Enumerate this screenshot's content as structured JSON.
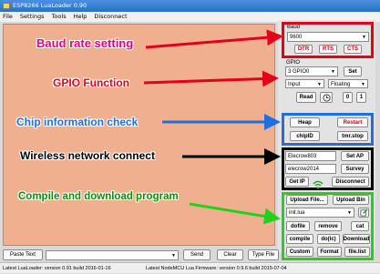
{
  "window": {
    "title": "ESP8266 LuaLoader 0.90"
  },
  "menu": {
    "items": [
      "File",
      "Settings",
      "Tools",
      "Help",
      "Disconnect"
    ]
  },
  "annotations": {
    "baud": "Baud rate setting",
    "gpio": "GPIO Function",
    "chip": "Chip information check",
    "wireless": "Wireless network connect",
    "compile": "Compile and download program"
  },
  "colors": {
    "red": "#e3001b",
    "blue": "#1f6fe0",
    "black": "#000000",
    "green": "#21d11b",
    "magenta": "#e4007f",
    "editor_bg": "#f0b08f"
  },
  "baud": {
    "section_label": "Baud",
    "value": "9600",
    "dtr": "DTR",
    "rts": "RTS",
    "cts": "CTS"
  },
  "gpio": {
    "section_label": "GPIO",
    "pin": "3 GPIO0",
    "set": "Set",
    "mode": "Input",
    "pull": "Floating",
    "read": "Read",
    "clock_icon": "clock-icon",
    "val0": "0",
    "val1": "1"
  },
  "chip": {
    "heap": "Heap",
    "restart": "Restart",
    "chipid": "chipID",
    "tmrstop": "tmr.stop"
  },
  "wifi": {
    "ssid": "Elecrow803",
    "password": "elecrow2014",
    "set_ap": "Set AP",
    "survey": "Survey",
    "get_ip": "Get IP",
    "disconnect": "Disconnect"
  },
  "program": {
    "upload_file": "Upload File...",
    "upload_bin": "Upload Bin",
    "file": "init.lua",
    "dofile": "dofile",
    "remove": "remove",
    "cat": "cat",
    "compile": "compile",
    "do_lc": "do(lc)",
    "download": "Download",
    "custom": "Custom",
    "format": "Format",
    "file_list": "file.list"
  },
  "bottom": {
    "paste_text": "Paste Text",
    "send": "Send",
    "clear": "Clear",
    "type_file": "Type File"
  },
  "status": {
    "left": "Latest LuaLoader:  version 0.91  build 2016-01-16",
    "right": "Latest NodeMCU Lua Firmware:  version 0.9.6 build 2015-07-04"
  }
}
